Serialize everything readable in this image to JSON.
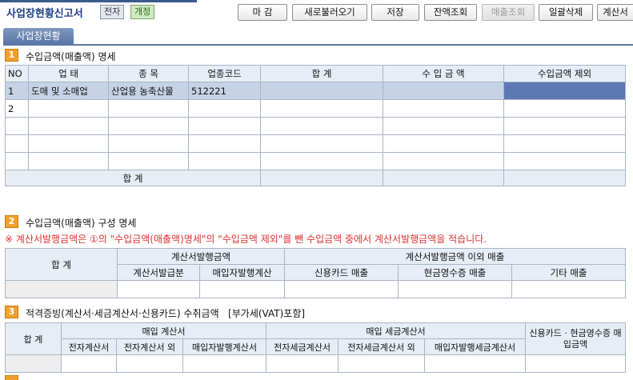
{
  "header": {
    "title": "사업장현황신고서",
    "badge_electronic": "전자",
    "badge_revised": "개정",
    "buttons": [
      "마 감",
      "새로불러오기",
      "저장",
      "잔액조회",
      "매출조회",
      "일괄삭제",
      "계산서"
    ]
  },
  "tab": {
    "label": "사업장현황"
  },
  "section1": {
    "num": "1",
    "title": "수입금액(매출액) 명세",
    "headers": [
      "NO",
      "업    태",
      "종    목",
      "업종코드",
      "합    계",
      "수 입 금 액",
      "수입금액 제외"
    ],
    "rows": [
      {
        "no": "1",
        "biz_type": "도매 및 소매업",
        "item": "산업용 농축산물",
        "code": "512221",
        "total": "",
        "income": "",
        "excluded": ""
      },
      {
        "no": "2",
        "biz_type": "",
        "item": "",
        "code": "",
        "total": "",
        "income": "",
        "excluded": ""
      },
      {
        "no": "",
        "biz_type": "",
        "item": "",
        "code": "",
        "total": "",
        "income": "",
        "excluded": ""
      },
      {
        "no": "",
        "biz_type": "",
        "item": "",
        "code": "",
        "total": "",
        "income": "",
        "excluded": ""
      },
      {
        "no": "",
        "biz_type": "",
        "item": "",
        "code": "",
        "total": "",
        "income": "",
        "excluded": ""
      }
    ],
    "total_label": "합        계"
  },
  "section2": {
    "num": "2",
    "title": "수입금액(매출액) 구성 명세",
    "notice": "※ 계산서발행금액은 ①의 \"수입금액(매출액)명세\"의 \"수입금액 제외\"를 뺀 수입금액 중에서 계산서발행금액을 적습니다.",
    "total_label": "합    계",
    "group_invoice": "계산서발행금액",
    "group_other": "계산서발행금액 이외 매출",
    "col_invoice_issued": "계산서발급분",
    "col_buyer_issued": "매입자발행계산",
    "col_card": "신용카드 매출",
    "col_cash_receipt": "현금영수증 매출",
    "col_other": "기타 매출"
  },
  "section3": {
    "num": "3",
    "title": "적격증빙(계산서·세금계산서·신용카드) 수취금액",
    "vat_note": "[부가세(VAT)포함]",
    "total_label": "합    계",
    "group_invoice": "매입 계산서",
    "group_tax_invoice": "매입 세금계산서",
    "col_card_cash": "신용카드 · 현금영수증 매입금액",
    "sub_cols": [
      "전자계산서",
      "전자계산서 외",
      "매입자발행계산서",
      "전자세금계산서",
      "전자세금계산서 외",
      "매입자발행세금계산서"
    ]
  },
  "colors": {
    "header_title": "#1d3f86",
    "tab_bg": "#5a76a8",
    "section_badge": "#f0a030",
    "selected_row": "#c6d3e6",
    "selected_cell": "#5d78b2",
    "table_header": "#e6edf5",
    "notice": "#e03030"
  }
}
